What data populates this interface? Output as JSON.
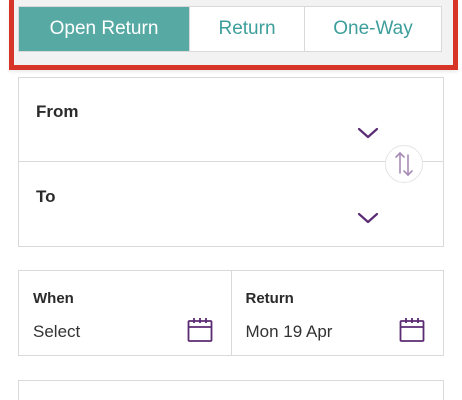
{
  "journey_tabs": {
    "open_return": "Open Return",
    "return": "Return",
    "one_way": "One-Way",
    "selected": "Open Return"
  },
  "route": {
    "from_label": "From",
    "to_label": "To"
  },
  "dates": {
    "when_label": "When",
    "when_value": "Select",
    "return_label": "Return",
    "return_value": "Mon 19 Apr"
  },
  "colors": {
    "accent": "#57a9a4",
    "tab_text": "#3d9f9b",
    "icon_purple": "#5b2b73",
    "highlight": "#d63527"
  },
  "icons": [
    "chevron-down-icon",
    "swap-icon",
    "calendar-icon"
  ]
}
